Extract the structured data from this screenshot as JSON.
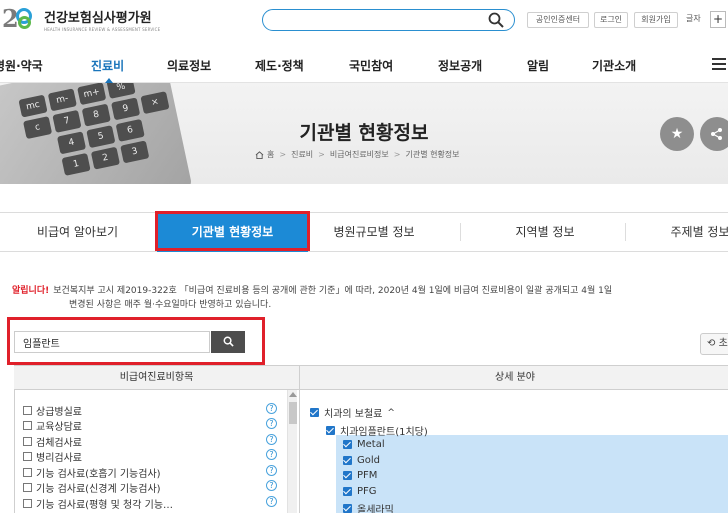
{
  "header": {
    "logo_text": "건강보험심사평가원",
    "logo_sub": "HEALTH INSURANCE REVIEW & ASSESSMENT SERVICE",
    "search_placeholder": "",
    "util_links": [
      "공인인증센터",
      "로그인",
      "회원가입"
    ],
    "font_size_label": "글자",
    "font_size_plus": "+"
  },
  "gnb": {
    "items": [
      "병원·약국",
      "진료비",
      "의료정보",
      "제도·정책",
      "국민참여",
      "정보공개",
      "알림",
      "기관소개"
    ],
    "active_index": 1
  },
  "hero": {
    "title": "기관별 현황정보",
    "breadcrumb": [
      "홈",
      "진료비",
      "비급여진료비정보",
      "기관별 현황정보"
    ],
    "calc_keys": [
      "mc",
      "m-",
      "m+",
      "%",
      "c",
      "7",
      "8",
      "9",
      "×",
      "4",
      "5",
      "6",
      "1",
      "2",
      "3"
    ],
    "star": "★"
  },
  "tabs": {
    "items": [
      "비급여 알아보기",
      "기관별 현황정보",
      "병원규모별 정보",
      "지역별 정보",
      "주제별 정보"
    ],
    "active_index": 1
  },
  "notice": {
    "label": "알립니다!",
    "line1": "보건복지부 고시 제2019-322호 「비급여 진료비용 등의 공개에 관한 기준」에 따라, 2020년 4월 1일에 비급여 진료비용이 일괄 공개되고 4월 1일",
    "line2": "변경된 사항은 매주 월·수요일마다 반영하고 있습니다."
  },
  "search": {
    "keyword_value": "임플란트",
    "reset_label": "초"
  },
  "table": {
    "col_left": "비급여진료비항목",
    "col_right": "상세 분야",
    "left_items": [
      "상급병실료",
      "교육상담료",
      "검체검사료",
      "병리검사료",
      "기능 검사료(호흡기 기능검사)",
      "기능 검사료(신경계 기능검사)",
      "기능 검사료(평형 및 청각 기능…"
    ],
    "help_glyph": "?",
    "right_group": "치과의 보철료",
    "right_sub": "치과임플란트(1치당)",
    "right_items": [
      "Metal",
      "Gold",
      "PFM",
      "PFG",
      "올세라믹"
    ]
  }
}
